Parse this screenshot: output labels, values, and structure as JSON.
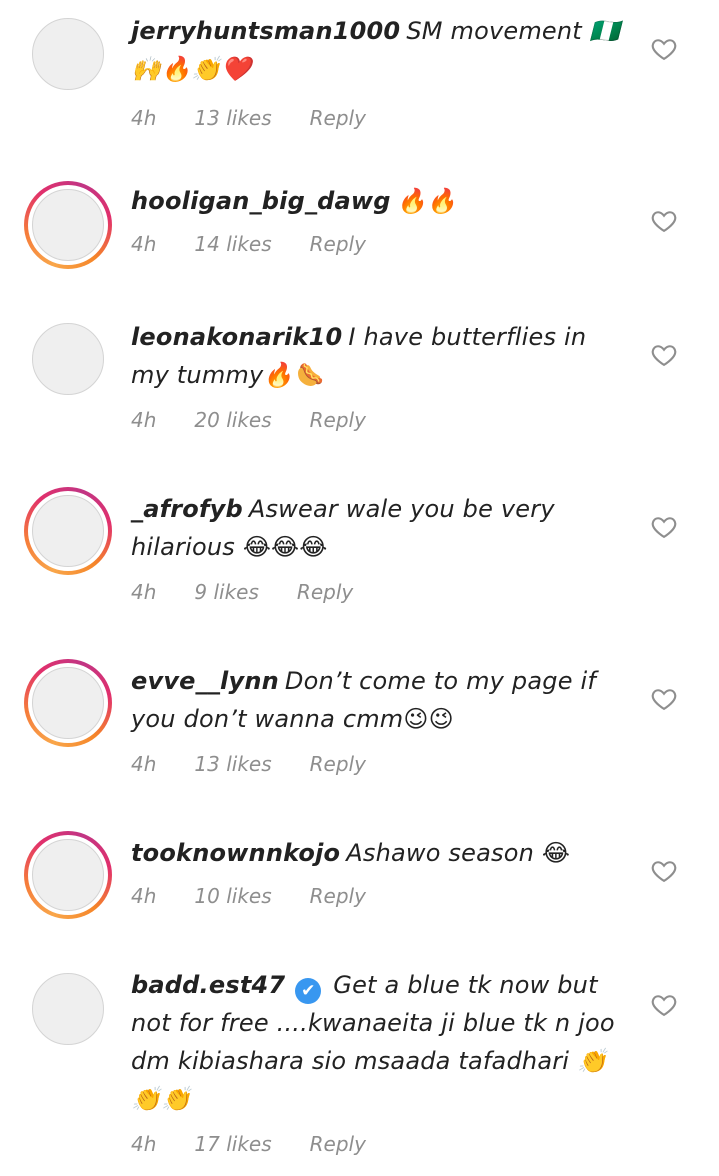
{
  "comments": [
    {
      "user": "jerryhuntsman1000",
      "text": "SM movement 🇳🇬 🙌🔥👏❤️",
      "time": "4h",
      "likes": "13 likes",
      "reply": "Reply",
      "story_ring": false,
      "verified": false
    },
    {
      "user": "hooligan_big_dawg",
      "text": "🔥🔥",
      "time": "4h",
      "likes": "14 likes",
      "reply": "Reply",
      "story_ring": true,
      "verified": false
    },
    {
      "user": "leonakonarik10",
      "text": "I have butterflies in my tummy🔥🌭",
      "time": "4h",
      "likes": "20 likes",
      "reply": "Reply",
      "story_ring": false,
      "verified": false
    },
    {
      "user": "_afrofyb",
      "text": "Aswear wale you be very hilarious 😂😂😂",
      "time": "4h",
      "likes": "9 likes",
      "reply": "Reply",
      "story_ring": true,
      "verified": false
    },
    {
      "user": "evve__lynn",
      "text": "Don’t come to my page if you don’t wanna cmm😉😉",
      "time": "4h",
      "likes": "13 likes",
      "reply": "Reply",
      "story_ring": true,
      "verified": false
    },
    {
      "user": "tooknownnkojo",
      "text": "Ashawo season 😂",
      "time": "4h",
      "likes": "10 likes",
      "reply": "Reply",
      "story_ring": true,
      "verified": false
    },
    {
      "user": "badd.est47",
      "text": "Get a blue tk now but not for free ....kwanaeita ji blue tk n joo dm kibiashara sio msaada tafadhari 👏👏👏",
      "time": "4h",
      "likes": "17 likes",
      "reply": "Reply",
      "story_ring": false,
      "verified": true
    }
  ],
  "verified_mark": "✔",
  "icons": {
    "like": "heart-outline-icon"
  }
}
